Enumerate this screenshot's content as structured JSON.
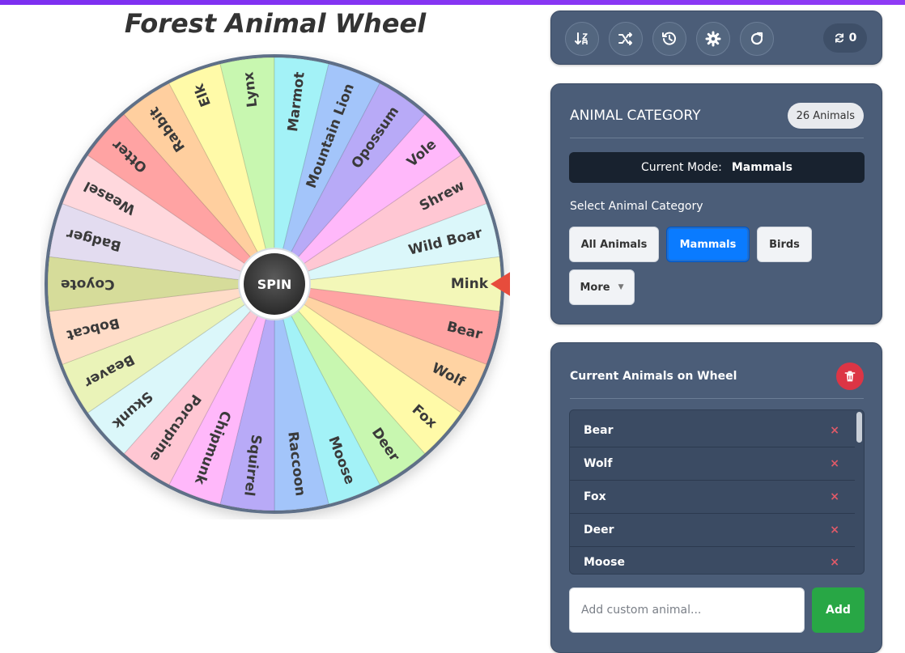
{
  "title": "Forest Animal Wheel",
  "spin_label": "SPIN",
  "wheel": {
    "segments": [
      {
        "label": "Mink",
        "color": "#f3f7b8"
      },
      {
        "label": "Bear",
        "color": "#ffa3a3"
      },
      {
        "label": "Wolf",
        "color": "#ffd3a3"
      },
      {
        "label": "Fox",
        "color": "#fffaa8"
      },
      {
        "label": "Deer",
        "color": "#c8f7b0"
      },
      {
        "label": "Moose",
        "color": "#a3f2f7"
      },
      {
        "label": "Raccoon",
        "color": "#a3c5fa"
      },
      {
        "label": "Squirrel",
        "color": "#b8aaf7"
      },
      {
        "label": "Chipmunk",
        "color": "#ffb8fa"
      },
      {
        "label": "Porcupine",
        "color": "#ffc7d3"
      },
      {
        "label": "Skunk",
        "color": "#dbf7fa"
      },
      {
        "label": "Beaver",
        "color": "#eaf3b8"
      },
      {
        "label": "Bobcat",
        "color": "#ffdcc8"
      },
      {
        "label": "Coyote",
        "color": "#d6dc9a"
      },
      {
        "label": "Badger",
        "color": "#e3dcf0"
      },
      {
        "label": "Weasel",
        "color": "#ffd8dd"
      },
      {
        "label": "Otter",
        "color": "#ffa3a3"
      },
      {
        "label": "Rabbit",
        "color": "#ffcf9f"
      },
      {
        "label": "Elk",
        "color": "#fffaa8"
      },
      {
        "label": "Lynx",
        "color": "#c8f7b0"
      },
      {
        "label": "Marmot",
        "color": "#a3f2f7"
      },
      {
        "label": "Mountain Lion",
        "color": "#a3c5fa"
      },
      {
        "label": "Opossum",
        "color": "#b8aaf7"
      },
      {
        "label": "Vole",
        "color": "#ffb8fa"
      },
      {
        "label": "Shrew",
        "color": "#ffc7d3"
      },
      {
        "label": "Wild Boar",
        "color": "#dbf7fa"
      }
    ],
    "rim_color": "#5e7088",
    "pointer_color": "#e74c3c"
  },
  "toolbar": {
    "icons": [
      "sort-icon",
      "shuffle-icon",
      "history-icon",
      "settings-icon",
      "redo-icon"
    ],
    "spin_count": "0"
  },
  "category": {
    "title": "ANIMAL CATEGORY",
    "count_badge": "26 Animals",
    "mode_label": "Current Mode:",
    "mode_value": "Mammals",
    "select_label": "Select Animal Category",
    "buttons": [
      "All Animals",
      "Mammals",
      "Birds",
      "More"
    ],
    "active": "Mammals"
  },
  "list": {
    "title": "Current Animals on Wheel",
    "items": [
      "Bear",
      "Wolf",
      "Fox",
      "Deer",
      "Moose"
    ],
    "remove_symbol": "×",
    "input_placeholder": "Add custom animal...",
    "add_label": "Add"
  }
}
